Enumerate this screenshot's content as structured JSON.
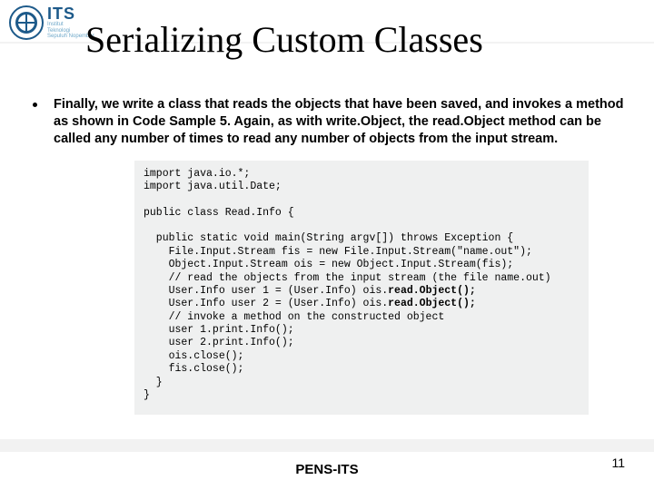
{
  "logo": {
    "acronym": "ITS",
    "line1": "Institut",
    "line2": "Teknologi",
    "line3": "Sepuluh Nopember"
  },
  "title": "Serializing Custom Classes",
  "bullet": "Finally, we write a class that reads the objects that have been saved, and invokes a method as shown in Code Sample 5. Again, as with write.Object, the read.Object method can be called any number of times to read any number of objects from the input stream.",
  "code": {
    "l1": "import java.io.*;",
    "l2": "import java.util.Date;",
    "l3": "public class Read.Info {",
    "l4": "  public static void main(String argv[]) throws Exception {",
    "l5": "    File.Input.Stream fis = new File.Input.Stream(\"name.out\");",
    "l6": "    Object.Input.Stream ois = new Object.Input.Stream(fis);",
    "l7": "    // read the objects from the input stream (the file name.out)",
    "l8a": "    User.Info user 1 = (User.Info) ois.",
    "l8b": "read.Object();",
    "l9a": "    User.Info user 2 = (User.Info) ois.",
    "l9b": "read.Object();",
    "l10": "    // invoke a method on the constructed object",
    "l11": "    user 1.print.Info();",
    "l12": "    user 2.print.Info();",
    "l13": "    ois.close();",
    "l14": "    fis.close();",
    "l15": "  }",
    "l16": "}"
  },
  "footer": "PENS-ITS",
  "page": "11"
}
